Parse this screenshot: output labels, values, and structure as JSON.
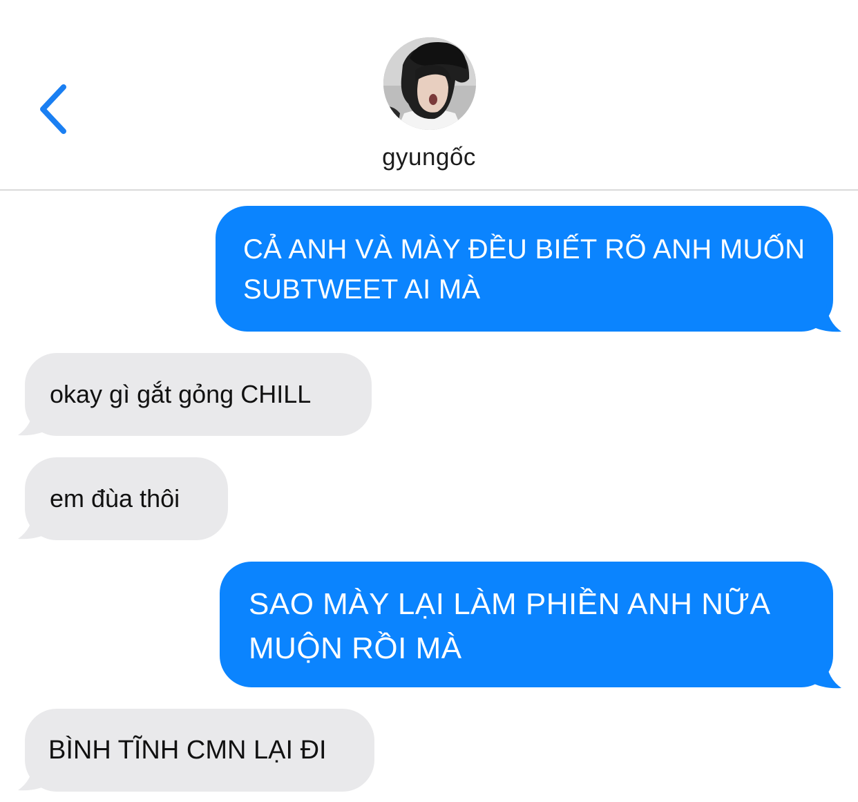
{
  "header": {
    "back_icon": "chevron-left-icon",
    "contact_name": "gyungốc",
    "avatar_icon": "contact-avatar"
  },
  "colors": {
    "sent_bubble": "#0b84fe",
    "received_bubble": "#e9e9eb",
    "accent": "#1a7ff2",
    "divider": "#d9d9d9"
  },
  "messages": [
    {
      "direction": "sent",
      "text": "CẢ ANH VÀ MÀY ĐỀU BIẾT RÕ ANH MUỐN\nSUBTWEET AI MÀ"
    },
    {
      "direction": "received",
      "text": "okay gì gắt gỏng CHILL"
    },
    {
      "direction": "received",
      "text": "em đùa thôi"
    },
    {
      "direction": "sent",
      "text": "SAO MÀY LẠI LÀM PHIỀN ANH NỮA\nMUỘN RỒI MÀ"
    },
    {
      "direction": "received",
      "text": "BÌNH TĨNH CMN LẠI ĐI"
    }
  ]
}
